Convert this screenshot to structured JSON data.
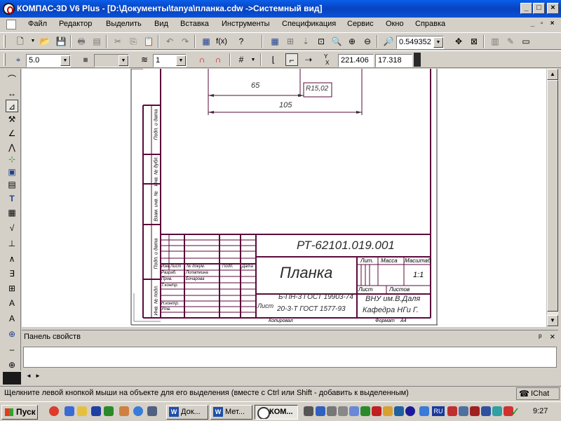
{
  "window": {
    "title": "КОМПАС-3D V6 Plus - [D:\\Документы\\tanya\\планка.cdw ->Системный вид]",
    "minimize_icon": "minimize-icon",
    "maximize_icon": "maximize-icon",
    "close_icon": "close-icon"
  },
  "menu": [
    "Файл",
    "Редактор",
    "Выделить",
    "Вид",
    "Вставка",
    "Инструменты",
    "Спецификация",
    "Сервис",
    "Окно",
    "Справка"
  ],
  "mdi": {
    "min": "_",
    "restore": "▫",
    "close": "×"
  },
  "toolbar1": {
    "zoom_value": "0.549352"
  },
  "toolbar2": {
    "step_value": "5.0",
    "layer_value": "1",
    "x_label": "X",
    "y_label": "Y",
    "x_coord": "221.406",
    "y_coord": "17.318"
  },
  "drawing": {
    "dim1": "65",
    "dim2": "105",
    "radius_note": "R15,02",
    "doc_code": "РТ-62101.019.001",
    "part_name": "Планка",
    "material_line1": "Б-ПН-3 ГОСТ 19903-74",
    "material_line2": "20-3-Т ГОСТ 1577-93",
    "list_label": "Лист",
    "org_line1": "ВНУ им.В.Даля",
    "org_line2": "Кафедра НГи Г.",
    "lit_label": "Лит.",
    "mass_label": "Масса",
    "scale_label": "Масштаб",
    "scale_value": "1:1",
    "sheet_label": "Лист",
    "sheets_label": "Листов",
    "copied_label": "Копировал",
    "format_label": "Формат",
    "format_value": "А4",
    "row_izm": "Изм.",
    "row_list": "Лист",
    "row_docnum": "№ докум.",
    "row_sign": "Подп.",
    "row_date": "Дата",
    "row_razrab": "Разраб.",
    "row_prov": "Пров.",
    "row_tkontr": "Т.контр.",
    "row_nkontr": "Н.контр.",
    "row_utv": "Утв.",
    "razrab_name": "Лопаткина",
    "prov_name": "Бочарова",
    "side1": "Подп. и дата",
    "side2": "Инв. № дубл.",
    "side3": "Взам. инв. №",
    "side4": "Подп. и дата",
    "side5": "Инв. № подл."
  },
  "props_panel": {
    "title": "Панель свойств",
    "pin": "ᵖ",
    "close": "×",
    "nav_left": "◄",
    "nav_right": "►"
  },
  "status": {
    "text": "Щелкните левой кнопкой мыши на объекте для его выделения (вместе с Ctrl или Shift - добавить к выделенным)",
    "chat": "IChat"
  },
  "taskbar": {
    "start": "Пуск",
    "tasks": [
      "Док...",
      "Мет...",
      "КОМ..."
    ],
    "lang": "RU",
    "clock": "9:27"
  }
}
